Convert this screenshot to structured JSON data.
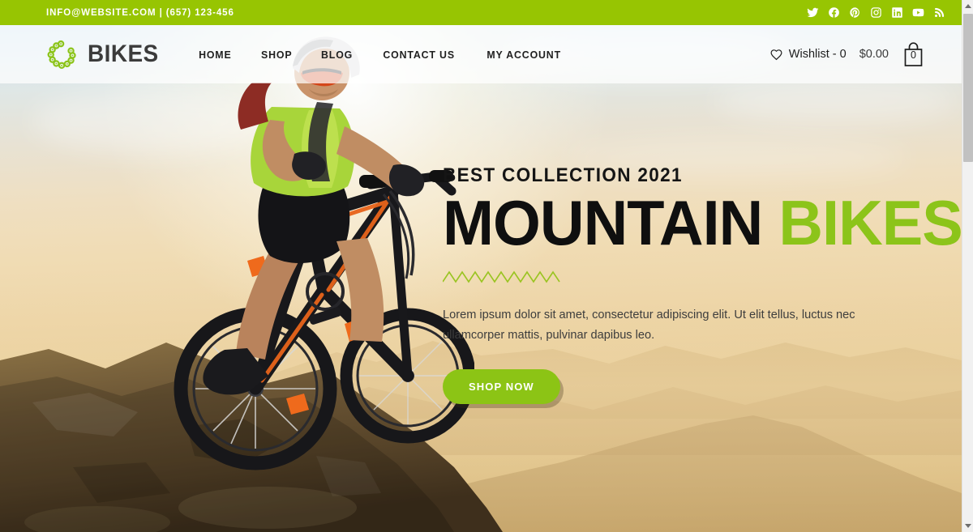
{
  "topbar": {
    "contact": "INFO@WEBSITE.COM | (657) 123-456",
    "background_color": "#97C502",
    "social": [
      {
        "name": "twitter-icon",
        "label": "Twitter"
      },
      {
        "name": "facebook-icon",
        "label": "Facebook"
      },
      {
        "name": "pinterest-icon",
        "label": "Pinterest"
      },
      {
        "name": "instagram-icon",
        "label": "Instagram"
      },
      {
        "name": "linkedin-icon",
        "label": "LinkedIn"
      },
      {
        "name": "youtube-icon",
        "label": "YouTube"
      },
      {
        "name": "rss-icon",
        "label": "RSS"
      }
    ]
  },
  "header": {
    "logo_text": "BIKES",
    "logo_icon": "bike-chain-icon",
    "nav": [
      {
        "label": "HOME"
      },
      {
        "label": "SHOP"
      },
      {
        "label": "BLOG"
      },
      {
        "label": "CONTACT US"
      },
      {
        "label": "MY ACCOUNT"
      }
    ],
    "wishlist_label": "Wishlist - 0",
    "wishlist_icon": "heart-icon",
    "cart_total": "$0.00",
    "cart_count": "0",
    "cart_icon": "shopping-bag-icon"
  },
  "hero": {
    "eyebrow": "BEST COLLECTION 2021",
    "headline_dark": "MOUNTAIN",
    "headline_accent": "BIKES",
    "divider_icon": "zigzag-divider",
    "paragraph": "Lorem ipsum dolor sit amet, consectetur adipiscing elit. Ut elit tellus, luctus nec ullamcorper mattis, pulvinar dapibus leo.",
    "cta_label": "SHOP NOW",
    "accent_color": "#8CC415",
    "image_description": "Mountain biker in lime green jersey riding down a rocky cliff at sunset with hazy mountain ridges in the background"
  },
  "scrollbar": {
    "up_icon": "scroll-up-arrow-icon",
    "down_icon": "scroll-down-arrow-icon"
  }
}
